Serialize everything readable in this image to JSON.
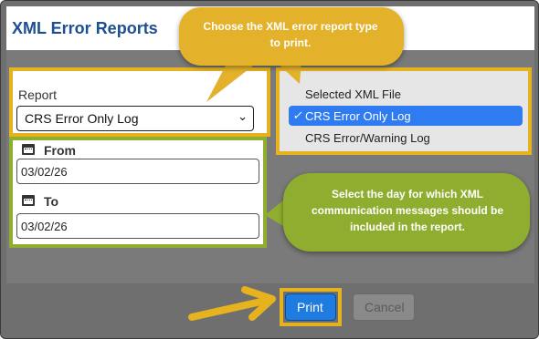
{
  "dialog": {
    "title": "XML Error Reports"
  },
  "report": {
    "label": "Report",
    "selected_value": "CRS Error Only Log",
    "options": [
      "Selected XML File",
      "CRS Error Only Log",
      "CRS Error/Warning Log"
    ],
    "selected_index": 1
  },
  "dates": {
    "from_label": "From",
    "from_value": "03/02/26",
    "to_label": "To",
    "to_value": "03/02/26"
  },
  "buttons": {
    "print_label": "Print",
    "cancel_label": "Cancel"
  },
  "callouts": {
    "report_type": "Choose the XML error report type to print.",
    "day_select": "Select the day for which XML communication messages should be included in the report."
  },
  "colors": {
    "title": "#1d4f91",
    "callout_yellow": "#e3b22a",
    "callout_green": "#8fae2f",
    "print_button": "#1e7be0",
    "dropdown_selected": "#2f7cf2"
  },
  "icons": {
    "calendar": "calendar-icon",
    "checkmark": "checkmark-icon",
    "chevron": "chevron-down-icon",
    "arrow": "arrow-right-icon"
  }
}
